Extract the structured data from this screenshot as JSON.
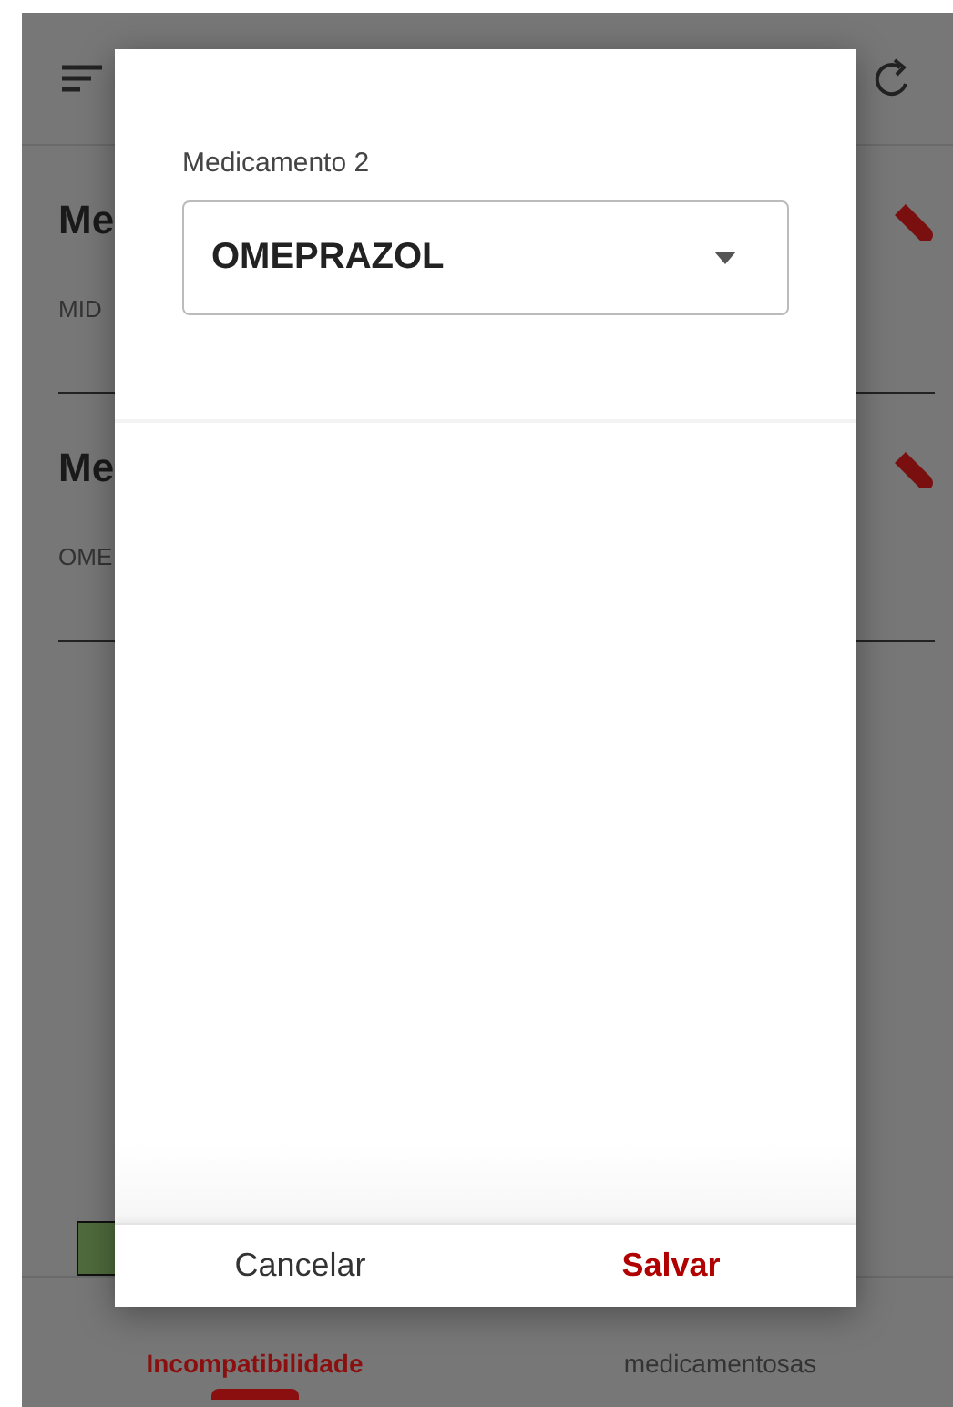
{
  "background": {
    "cards": [
      {
        "title": "Me",
        "subtitle": "MID"
      },
      {
        "title": "Me",
        "subtitle": "OME"
      }
    ],
    "bottom_nav": [
      {
        "label": "Incompatibilidade",
        "selected": true
      },
      {
        "label": "medicamentosas",
        "selected": false
      }
    ]
  },
  "dialog": {
    "field_label": "Medicamento 2",
    "select_value": "OMEPRAZOL",
    "buttons": [
      {
        "label": "Cancelar",
        "kind": "secondary"
      },
      {
        "label": "Salvar",
        "kind": "primary"
      }
    ]
  }
}
